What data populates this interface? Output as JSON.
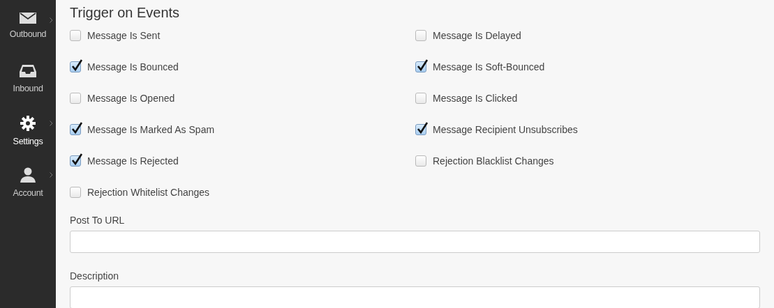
{
  "sidebar": {
    "items": [
      {
        "label": "Outbound",
        "kind": "envelope",
        "submenu": true,
        "selected": false
      },
      {
        "label": "Inbound",
        "kind": "tray",
        "submenu": false,
        "selected": false
      },
      {
        "label": "Settings",
        "kind": "gear",
        "submenu": true,
        "selected": true
      },
      {
        "label": "Account",
        "kind": "person",
        "submenu": true,
        "selected": false
      }
    ]
  },
  "heading": "Trigger on Events",
  "events": [
    {
      "label": "Message Is Sent",
      "checked": false
    },
    {
      "label": "Message Is Delayed",
      "checked": false
    },
    {
      "label": "Message Is Bounced",
      "checked": true
    },
    {
      "label": "Message Is Soft-Bounced",
      "checked": true
    },
    {
      "label": "Message Is Opened",
      "checked": false
    },
    {
      "label": "Message Is Clicked",
      "checked": false
    },
    {
      "label": "Message Is Marked As Spam",
      "checked": true
    },
    {
      "label": "Message Recipient Unsubscribes",
      "checked": true
    },
    {
      "label": "Message Is Rejected",
      "checked": true
    },
    {
      "label": "Rejection Blacklist Changes",
      "checked": false
    },
    {
      "label": "Rejection Whitelist Changes",
      "checked": false
    }
  ],
  "fields": [
    {
      "label": "Post To URL"
    },
    {
      "label": "Description"
    }
  ]
}
